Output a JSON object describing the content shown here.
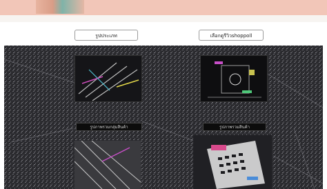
{
  "top_buttons": [
    {
      "label": "รูปประเภท"
    },
    {
      "label": "เลือกดูรีวิวshoppoll"
    }
  ],
  "cards": [
    {
      "badge": "รูปภาพรวมกลุ่มสินค้า"
    },
    {
      "badge": "รูปภาพรวมสินค้า"
    }
  ],
  "colors": {
    "banner": "#f2c6b8",
    "page": "#ffffff",
    "dark": "#1a1a1c"
  }
}
